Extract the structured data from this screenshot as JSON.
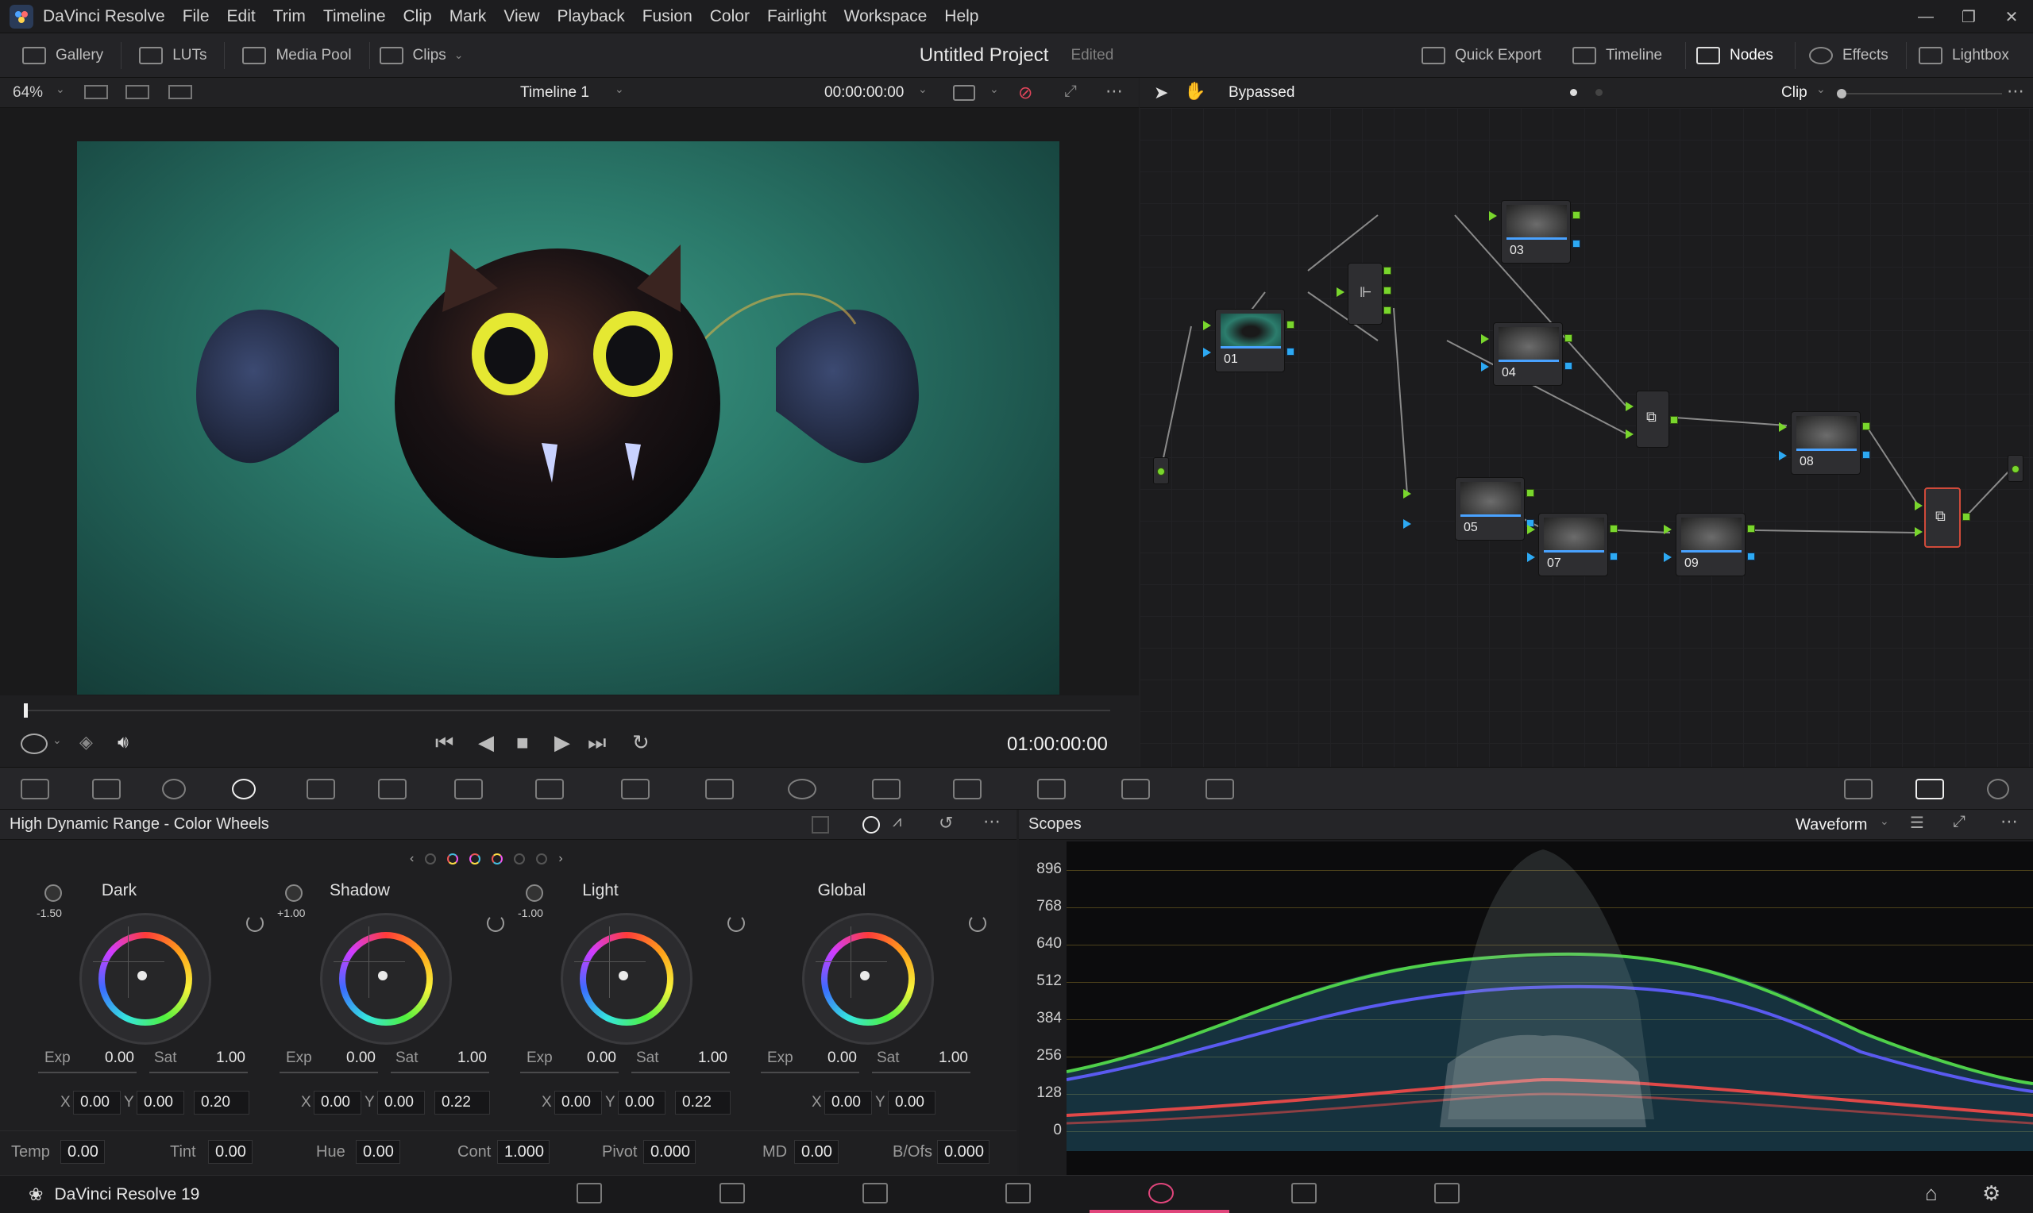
{
  "menubar": {
    "app_name": "DaVinci Resolve",
    "items": [
      "File",
      "Edit",
      "Trim",
      "Timeline",
      "Clip",
      "Mark",
      "View",
      "Playback",
      "Fusion",
      "Color",
      "Fairlight",
      "Workspace",
      "Help"
    ]
  },
  "toolbar": {
    "left": [
      "Gallery",
      "LUTs",
      "Media Pool",
      "Clips"
    ],
    "project_title": "Untitled Project",
    "project_status": "Edited",
    "right": [
      "Quick Export",
      "Timeline",
      "Nodes",
      "Effects",
      "Lightbox"
    ]
  },
  "viewer": {
    "zoom": "64%",
    "timeline_name": "Timeline 1",
    "source_timecode": "00:00:00:00",
    "playhead_timecode": "01:00:00:00"
  },
  "nodes_panel": {
    "mode_label": "Bypassed",
    "scope_select": "Clip",
    "nodes": [
      "01",
      "03",
      "04",
      "05",
      "07",
      "09",
      "08"
    ]
  },
  "wheels_panel": {
    "title": "High Dynamic Range - Color Wheels",
    "wheels": [
      {
        "name": "Dark",
        "knob": "-1.50",
        "exp": "0.00",
        "sat": "1.00",
        "x": "0.00",
        "y": "0.00",
        "fall": "0.20"
      },
      {
        "name": "Shadow",
        "knob": "+1.00",
        "exp": "0.00",
        "sat": "1.00",
        "x": "0.00",
        "y": "0.00",
        "fall": "0.22"
      },
      {
        "name": "Light",
        "knob": "-1.00",
        "exp": "0.00",
        "sat": "1.00",
        "x": "0.00",
        "y": "0.00",
        "fall": "0.22"
      },
      {
        "name": "Global",
        "knob": "",
        "exp": "0.00",
        "sat": "1.00",
        "x": "0.00",
        "y": "0.00",
        "fall": ""
      }
    ],
    "labels": {
      "exp": "Exp",
      "sat": "Sat",
      "x": "X",
      "y": "Y"
    },
    "bottom": {
      "temp_label": "Temp",
      "temp": "0.00",
      "tint_label": "Tint",
      "tint": "0.00",
      "hue_label": "Hue",
      "hue": "0.00",
      "cont_label": "Cont",
      "cont": "1.000",
      "pivot_label": "Pivot",
      "pivot": "0.000",
      "md_label": "MD",
      "md": "0.00",
      "bofs_label": "B/Ofs",
      "bofs": "0.000"
    }
  },
  "scopes_panel": {
    "title": "Scopes",
    "mode": "Waveform",
    "scale": [
      "896",
      "768",
      "640",
      "512",
      "384",
      "256",
      "128",
      "0"
    ]
  },
  "statusbar": {
    "product": "DaVinci Resolve 19"
  },
  "colors": {
    "accent_blue": "#49a2ff",
    "port_green": "#79d62d",
    "port_blue": "#2da9f3",
    "active_page": "#e0457b"
  }
}
